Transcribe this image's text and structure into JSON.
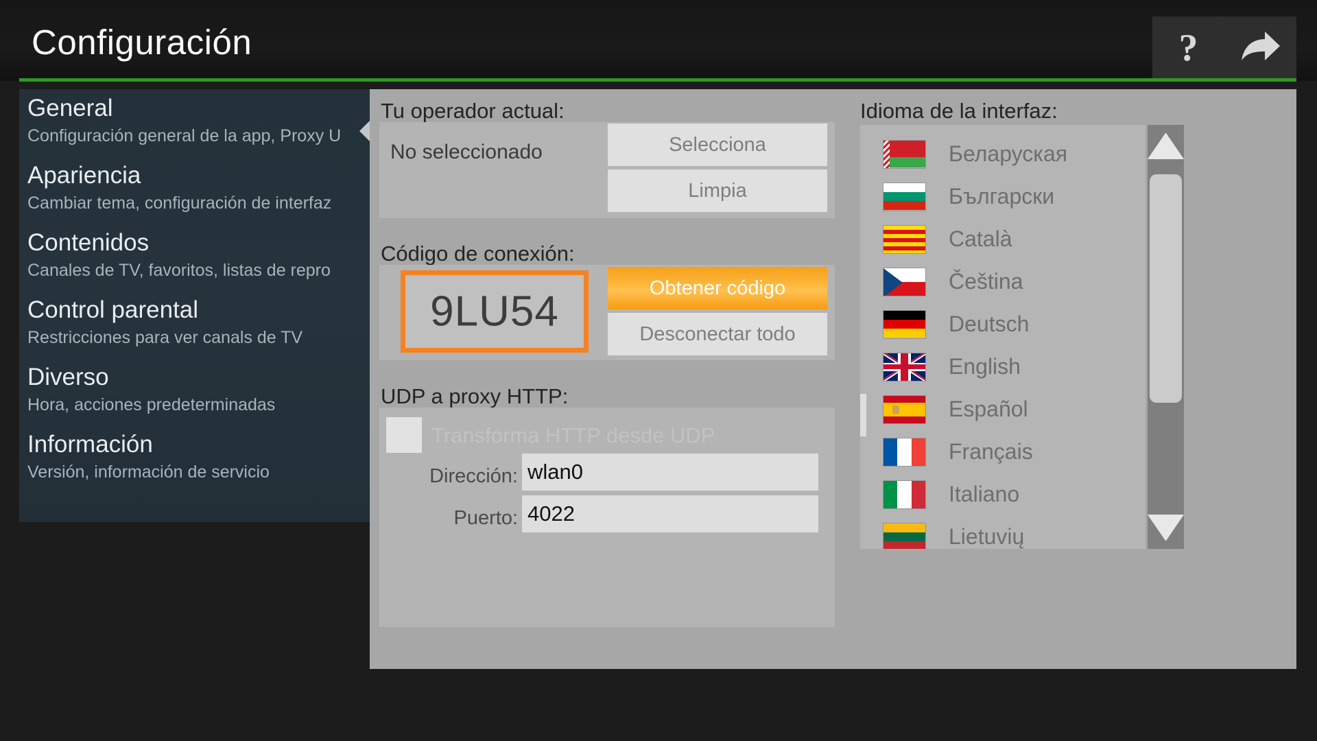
{
  "header": {
    "title": "Configuración",
    "help_icon": "question-mark-icon",
    "exit_icon": "share-arrow-icon",
    "accent_line_color": "#2e9a22"
  },
  "sidebar": {
    "items": [
      {
        "title": "General",
        "subtitle": "Configuración general de la app, Proxy U",
        "selected": true
      },
      {
        "title": "Apariencia",
        "subtitle": "Cambiar tema, configuración de interfaz",
        "selected": false
      },
      {
        "title": "Contenidos",
        "subtitle": "Canales de TV, favoritos, listas de repro",
        "selected": false
      },
      {
        "title": "Control parental",
        "subtitle": "Restricciones para ver canals de TV",
        "selected": false
      },
      {
        "title": "Diverso",
        "subtitle": "Hora, acciones predeterminadas",
        "selected": false
      },
      {
        "title": "Información",
        "subtitle": "Versión, información de servicio",
        "selected": false
      }
    ]
  },
  "main": {
    "operator": {
      "label": "Tu operador actual:",
      "value": "No seleccionado",
      "select_button": "Selecciona",
      "clear_button": "Limpia"
    },
    "connection": {
      "label": "Código de conexión:",
      "code": "9LU54",
      "code_focus_color": "#f58220",
      "get_code_button": "Obtener código",
      "disconnect_button": "Desconectar todo"
    },
    "udp_proxy": {
      "label": "UDP a proxy HTTP:",
      "checkbox_label": "Transforma HTTP desde UDP",
      "checkbox_checked": false,
      "address_label": "Dirección:",
      "address_value": "wlan0",
      "port_label": "Puerto:",
      "port_value": "4022"
    }
  },
  "language": {
    "label": "Idioma de la interfaz:",
    "selected": "Español",
    "items": [
      {
        "name": "Беларуская",
        "flag": "by"
      },
      {
        "name": "Български",
        "flag": "bg"
      },
      {
        "name": "Català",
        "flag": "ct"
      },
      {
        "name": "Čeština",
        "flag": "cz"
      },
      {
        "name": "Deutsch",
        "flag": "de"
      },
      {
        "name": "English",
        "flag": "gb"
      },
      {
        "name": "Español",
        "flag": "es"
      },
      {
        "name": "Français",
        "flag": "fr"
      },
      {
        "name": "Italiano",
        "flag": "it"
      },
      {
        "name": "Lietuvių",
        "flag": "lt"
      }
    ],
    "scrollbar": {
      "up_icon": "triangle-up-icon",
      "down_icon": "triangle-down-icon"
    }
  }
}
